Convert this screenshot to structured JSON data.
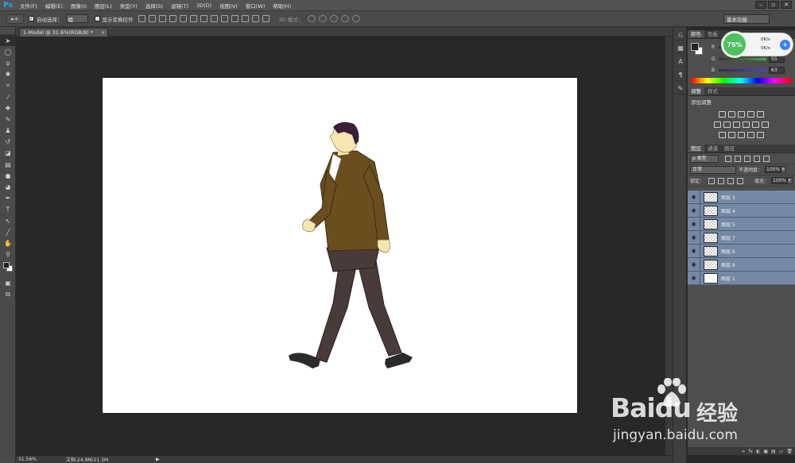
{
  "app": {
    "logo": "Ps"
  },
  "menu": [
    "文件(F)",
    "编辑(E)",
    "图像(I)",
    "图层(L)",
    "类型(Y)",
    "选择(S)",
    "滤镜(T)",
    "3D(D)",
    "视图(V)",
    "窗口(W)",
    "帮助(H)"
  ],
  "window_controls": {
    "minimize": "–",
    "restore": "▫",
    "close": "✕"
  },
  "options": {
    "auto_select_label": "自动选择：",
    "auto_select_value": "组",
    "show_transform_label": "显示变换控件",
    "mode3d_label": "3D 模式：",
    "workspace": "基本功能"
  },
  "document": {
    "tab_title": "1-Model @ 31.6%(RGB/8) *",
    "close": "×"
  },
  "status": {
    "zoom": "31.56%",
    "docinfo": "文档:24.9M/21.3M",
    "arrow": "▶"
  },
  "color_panel": {
    "tabs": [
      "颜色",
      "色板"
    ],
    "rows": [
      {
        "label": "R",
        "value": ""
      },
      {
        "label": "G",
        "value": "55"
      },
      {
        "label": "B",
        "value": "63"
      }
    ],
    "bars": [
      "#d44",
      "#4a4",
      "#44d"
    ]
  },
  "speed_widget": {
    "percent": "75%",
    "up": "0K/s",
    "down": "0K/s",
    "plus": "+"
  },
  "adjust_panel": {
    "tabs": [
      "调整",
      "样式"
    ],
    "title": "添加调整"
  },
  "layers_panel": {
    "tabs": [
      "图层",
      "通道",
      "路径"
    ],
    "filter_label": "ρ 类型",
    "blend_mode": "正常",
    "opacity_label": "不透明度：",
    "opacity_value": "100%",
    "lock_label": "锁定：",
    "fill_label": "填充：",
    "fill_value": "100%",
    "eye": "◉",
    "layers": [
      {
        "name": "图层 3",
        "thumb": "checker"
      },
      {
        "name": "图层 4",
        "thumb": "checker"
      },
      {
        "name": "图层 5",
        "thumb": "checker"
      },
      {
        "name": "图层 7",
        "thumb": "checker"
      },
      {
        "name": "图层 6",
        "thumb": "checker"
      },
      {
        "name": "图层 8",
        "thumb": "checker"
      },
      {
        "name": "图层 1",
        "thumb": "white"
      }
    ],
    "footer_icons": [
      "∞",
      "fx",
      "◐",
      "▣",
      "▤",
      "▭",
      "🗑"
    ]
  },
  "watermark": {
    "brand": "Bai",
    "brand2": "du",
    "cn": "经验",
    "url": "jingyan.baidu.com"
  },
  "colors": {
    "accent": "#2da6f0",
    "layer_selected": "#7589a6",
    "jacket": "#6b4e1e",
    "pants": "#4a3b3b",
    "hair": "#3a1e3a",
    "skin": "#f7e6b0"
  }
}
